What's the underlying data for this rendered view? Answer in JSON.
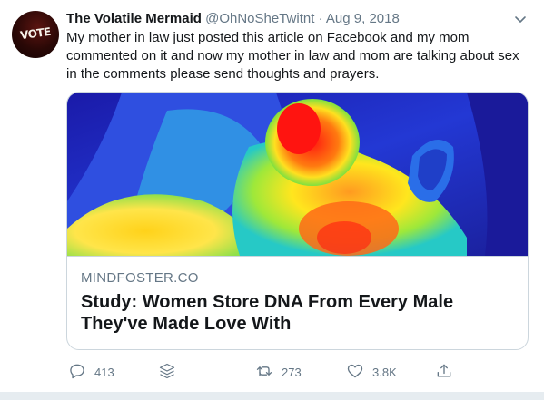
{
  "author": {
    "display_name": "The Volatile Mermaid",
    "handle": "@OhNoSheTwitnt",
    "separator": "·",
    "date": "Aug 9, 2018",
    "avatar_text": "VOTE"
  },
  "tweet": {
    "text": "My mother in law just posted this article on Facebook and my mom commented on it and now my mother in law and mom are talking about sex in the comments please send thoughts and prayers."
  },
  "card": {
    "domain": "MINDFOSTER.CO",
    "title": "Study: Women Store DNA From Every Male They've Made Love With"
  },
  "actions": {
    "reply_count": "413",
    "retweet_count": "273",
    "like_count": "3.8K"
  },
  "icons": {
    "caret": "chevron-down-icon",
    "reply": "reply-icon",
    "stack": "stack-icon",
    "retweet": "retweet-icon",
    "like": "heart-icon",
    "share": "share-icon"
  },
  "colors": {
    "text_primary": "#14171a",
    "text_secondary": "#657786",
    "border": "#ccd6dd",
    "strip": "#e6ecf0"
  }
}
